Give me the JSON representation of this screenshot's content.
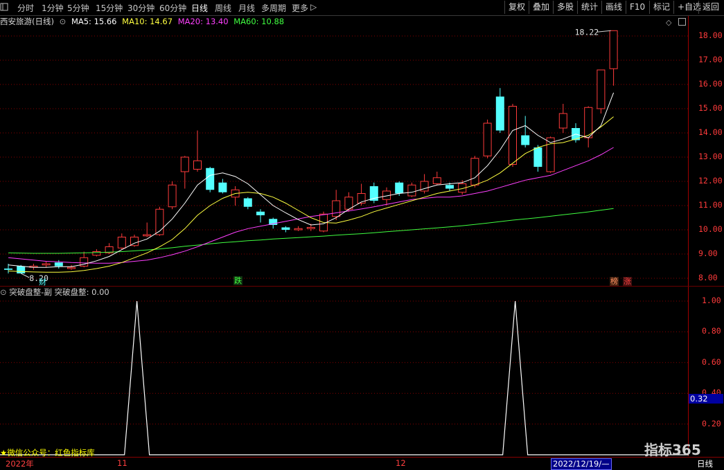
{
  "toolbar": {
    "periods": [
      "分时",
      "1分钟",
      "5分钟",
      "15分钟",
      "30分钟",
      "60分钟",
      "日线",
      "周线",
      "月线",
      "多周期",
      "更多"
    ],
    "more_arrow": "▷",
    "active_period": "日线",
    "right_buttons": [
      "复权",
      "叠加",
      "多股",
      "统计",
      "画线",
      "F10",
      "标记",
      "+自选",
      "返回"
    ]
  },
  "stock": {
    "name": "西安旅游(日线)",
    "ma5": "MA5: 15.66",
    "ma10": "MA10: 14.67",
    "ma20": "MA20: 13.40",
    "ma60": "MA60: 10.88"
  },
  "colors": {
    "up": "#ff3b3b",
    "down": "#54ffff",
    "ma5": "#ffffff",
    "ma10": "#ffff40",
    "ma20": "#ff40ff",
    "ma60": "#40ff40",
    "grid": "#8a0000"
  },
  "price_axis": [
    "18.00",
    "17.00",
    "16.00",
    "15.00",
    "14.00",
    "13.00",
    "12.00",
    "11.00",
    "10.00",
    "9.00",
    "8.00"
  ],
  "annotations": {
    "high_label": "18.22",
    "low_label": "8.20",
    "marker_cai": "财",
    "marker_die": "跌",
    "marker_bang": "榜",
    "marker_zhang": "涨"
  },
  "indicator": {
    "title": "突破盘整-副",
    "value_label": "突破盘整: 0.00",
    "axis": [
      "1.00",
      "0.80",
      "0.60",
      "0.40",
      "0.20"
    ],
    "current_value": "0.32",
    "signals": [
      1,
      1
    ]
  },
  "bottom_axis": {
    "labels": [
      "2022年",
      "11",
      "12"
    ],
    "cursor_date": "2022/12/19/—",
    "period": "日线"
  },
  "footer": {
    "wechat": "★微信公众号：红色指标库",
    "watermark": "指标365"
  },
  "chart_data": {
    "type": "candlestick",
    "ylim": [
      7.8,
      18.4
    ],
    "candles": [
      {
        "o": 8.4,
        "c": 8.35,
        "h": 8.6,
        "l": 8.2
      },
      {
        "o": 8.5,
        "c": 8.2,
        "h": 8.55,
        "l": 8.2
      },
      {
        "o": 8.45,
        "c": 8.5,
        "h": 8.6,
        "l": 8.35
      },
      {
        "o": 8.55,
        "c": 8.6,
        "h": 8.7,
        "l": 8.45
      },
      {
        "o": 8.65,
        "c": 8.5,
        "h": 8.75,
        "l": 8.4
      },
      {
        "o": 8.4,
        "c": 8.45,
        "h": 8.55,
        "l": 8.35
      },
      {
        "o": 8.5,
        "c": 8.85,
        "h": 9.1,
        "l": 8.45
      },
      {
        "o": 8.95,
        "c": 9.1,
        "h": 9.2,
        "l": 8.9
      },
      {
        "o": 9.05,
        "c": 9.3,
        "h": 9.45,
        "l": 9.0
      },
      {
        "o": 9.25,
        "c": 9.7,
        "h": 9.85,
        "l": 9.2
      },
      {
        "o": 9.35,
        "c": 9.7,
        "h": 9.8,
        "l": 9.3
      },
      {
        "o": 9.75,
        "c": 9.8,
        "h": 10.3,
        "l": 9.7
      },
      {
        "o": 9.8,
        "c": 10.85,
        "h": 10.95,
        "l": 9.75
      },
      {
        "o": 10.95,
        "c": 11.85,
        "h": 12.0,
        "l": 10.85
      },
      {
        "o": 12.4,
        "c": 13.0,
        "h": 13.05,
        "l": 11.7
      },
      {
        "o": 12.5,
        "c": 12.85,
        "h": 14.1,
        "l": 12.4
      },
      {
        "o": 12.55,
        "c": 11.65,
        "h": 12.6,
        "l": 11.55
      },
      {
        "o": 11.95,
        "c": 11.55,
        "h": 12.1,
        "l": 11.5
      },
      {
        "o": 11.35,
        "c": 11.65,
        "h": 11.8,
        "l": 11.0
      },
      {
        "o": 11.3,
        "c": 10.95,
        "h": 11.35,
        "l": 10.85
      },
      {
        "o": 10.75,
        "c": 10.6,
        "h": 10.85,
        "l": 10.3
      },
      {
        "o": 10.45,
        "c": 10.2,
        "h": 10.5,
        "l": 10.05
      },
      {
        "o": 10.1,
        "c": 10.0,
        "h": 10.15,
        "l": 9.9
      },
      {
        "o": 10.0,
        "c": 10.05,
        "h": 10.15,
        "l": 9.95
      },
      {
        "o": 10.05,
        "c": 10.1,
        "h": 10.25,
        "l": 9.95
      },
      {
        "o": 9.95,
        "c": 10.65,
        "h": 10.75,
        "l": 9.9
      },
      {
        "o": 10.55,
        "c": 11.2,
        "h": 11.65,
        "l": 10.4
      },
      {
        "o": 10.85,
        "c": 11.35,
        "h": 11.55,
        "l": 10.75
      },
      {
        "o": 11.1,
        "c": 11.5,
        "h": 11.9,
        "l": 11.0
      },
      {
        "o": 11.8,
        "c": 11.2,
        "h": 11.95,
        "l": 11.1
      },
      {
        "o": 11.25,
        "c": 11.6,
        "h": 11.75,
        "l": 11.0
      },
      {
        "o": 11.95,
        "c": 11.5,
        "h": 12.0,
        "l": 11.4
      },
      {
        "o": 11.4,
        "c": 11.85,
        "h": 11.95,
        "l": 11.35
      },
      {
        "o": 11.6,
        "c": 12.0,
        "h": 12.3,
        "l": 11.5
      },
      {
        "o": 11.9,
        "c": 12.15,
        "h": 12.4,
        "l": 11.85
      },
      {
        "o": 11.85,
        "c": 11.7,
        "h": 11.95,
        "l": 11.6
      },
      {
        "o": 11.55,
        "c": 11.9,
        "h": 12.05,
        "l": 11.45
      },
      {
        "o": 11.85,
        "c": 12.95,
        "h": 13.05,
        "l": 11.75
      },
      {
        "o": 13.05,
        "c": 14.4,
        "h": 14.55,
        "l": 12.95
      },
      {
        "o": 15.5,
        "c": 14.1,
        "h": 15.85,
        "l": 14.0
      },
      {
        "o": 12.7,
        "c": 15.1,
        "h": 15.2,
        "l": 12.6
      },
      {
        "o": 13.9,
        "c": 13.5,
        "h": 14.7,
        "l": 13.4
      },
      {
        "o": 13.4,
        "c": 12.6,
        "h": 13.5,
        "l": 12.4
      },
      {
        "o": 12.4,
        "c": 13.8,
        "h": 13.85,
        "l": 12.35
      },
      {
        "o": 14.2,
        "c": 14.8,
        "h": 15.2,
        "l": 14.0
      },
      {
        "o": 14.2,
        "c": 13.7,
        "h": 14.4,
        "l": 13.6
      },
      {
        "o": 13.8,
        "c": 15.05,
        "h": 15.1,
        "l": 13.4
      },
      {
        "o": 15.0,
        "c": 16.6,
        "h": 16.6,
        "l": 14.8
      },
      {
        "o": 16.65,
        "c": 18.22,
        "h": 18.22,
        "l": 15.95
      }
    ],
    "ma5": [
      8.55,
      8.5,
      8.45,
      8.45,
      8.48,
      8.48,
      8.58,
      8.72,
      8.9,
      9.18,
      9.45,
      9.62,
      9.95,
      10.45,
      11.1,
      11.85,
      12.25,
      12.35,
      12.2,
      11.9,
      11.45,
      11.0,
      10.7,
      10.42,
      10.2,
      10.25,
      10.5,
      10.85,
      11.15,
      11.3,
      11.4,
      11.5,
      11.55,
      11.7,
      11.85,
      11.9,
      11.95,
      12.15,
      12.65,
      13.3,
      14.1,
      14.3,
      13.9,
      13.6,
      13.75,
      13.95,
      13.8,
      14.3,
      15.66
    ],
    "ma10": [
      8.3,
      8.28,
      8.26,
      8.25,
      8.25,
      8.27,
      8.32,
      8.4,
      8.5,
      8.65,
      8.85,
      9.05,
      9.3,
      9.6,
      10.05,
      10.6,
      11.0,
      11.3,
      11.5,
      11.55,
      11.5,
      11.35,
      11.1,
      10.8,
      10.5,
      10.3,
      10.28,
      10.4,
      10.55,
      10.75,
      10.9,
      11.05,
      11.2,
      11.35,
      11.5,
      11.6,
      11.7,
      11.85,
      12.05,
      12.35,
      12.75,
      13.15,
      13.4,
      13.55,
      13.6,
      13.75,
      13.9,
      14.25,
      14.67
    ],
    "ma20": [
      8.85,
      8.8,
      8.75,
      8.7,
      8.68,
      8.65,
      8.63,
      8.62,
      8.62,
      8.65,
      8.7,
      8.75,
      8.85,
      8.97,
      9.12,
      9.3,
      9.5,
      9.7,
      9.9,
      10.05,
      10.15,
      10.25,
      10.35,
      10.45,
      10.55,
      10.62,
      10.7,
      10.78,
      10.86,
      10.95,
      11.05,
      11.15,
      11.25,
      11.3,
      11.35,
      11.35,
      11.4,
      11.5,
      11.6,
      11.75,
      11.9,
      12.05,
      12.15,
      12.25,
      12.45,
      12.65,
      12.85,
      13.1,
      13.4
    ],
    "ma60": [
      9.05,
      9.04,
      9.03,
      9.03,
      9.03,
      9.04,
      9.05,
      9.06,
      9.08,
      9.1,
      9.13,
      9.17,
      9.21,
      9.26,
      9.32,
      9.37,
      9.42,
      9.47,
      9.51,
      9.55,
      9.58,
      9.62,
      9.65,
      9.68,
      9.71,
      9.74,
      9.78,
      9.81,
      9.84,
      9.88,
      9.92,
      9.96,
      10.0,
      10.04,
      10.08,
      10.12,
      10.17,
      10.22,
      10.28,
      10.34,
      10.4,
      10.45,
      10.5,
      10.56,
      10.62,
      10.68,
      10.74,
      10.81,
      10.88
    ]
  }
}
